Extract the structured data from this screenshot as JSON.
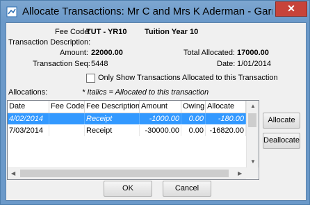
{
  "window": {
    "title": "Allocate Transactions: Mr C and Mrs K Aderman - Garry...",
    "close_glyph": "✕"
  },
  "fields": {
    "fee_code_label": "Fee Code:",
    "fee_code_value": "TUT - YR10",
    "fee_code_desc": "Tuition Year 10",
    "transaction_description_label": "Transaction Description:",
    "amount_label": "Amount:",
    "amount_value": "22000.00",
    "total_allocated_label": "Total Allocated:",
    "total_allocated_value": "17000.00",
    "transaction_seq_label": "Transaction Seq:",
    "transaction_seq_value": "5448",
    "date_label": "Date:",
    "date_value": "1/01/2014",
    "only_show_label": "Only Show Transactions Allocated to this Transaction",
    "allocations_label": "Allocations:",
    "italics_note": "* Italics = Allocated to this transaction"
  },
  "grid": {
    "columns": [
      "Date",
      "Fee Code",
      "Fee Description",
      "Amount",
      "Owing",
      "Allocate"
    ],
    "rows": [
      {
        "date": "4/02/2014",
        "fee_code": "",
        "fee_description": "Receipt",
        "amount": "-1000.00",
        "owing": "0.00",
        "allocate": "-180.00",
        "selected": true,
        "italic": true
      },
      {
        "date": "7/03/2014",
        "fee_code": "",
        "fee_description": "Receipt",
        "amount": "-30000.00",
        "owing": "0.00",
        "allocate": "-16820.00",
        "selected": false,
        "italic": false
      }
    ]
  },
  "buttons": {
    "allocate": "Allocate",
    "deallocate": "Deallocate",
    "ok": "OK",
    "cancel": "Cancel"
  }
}
